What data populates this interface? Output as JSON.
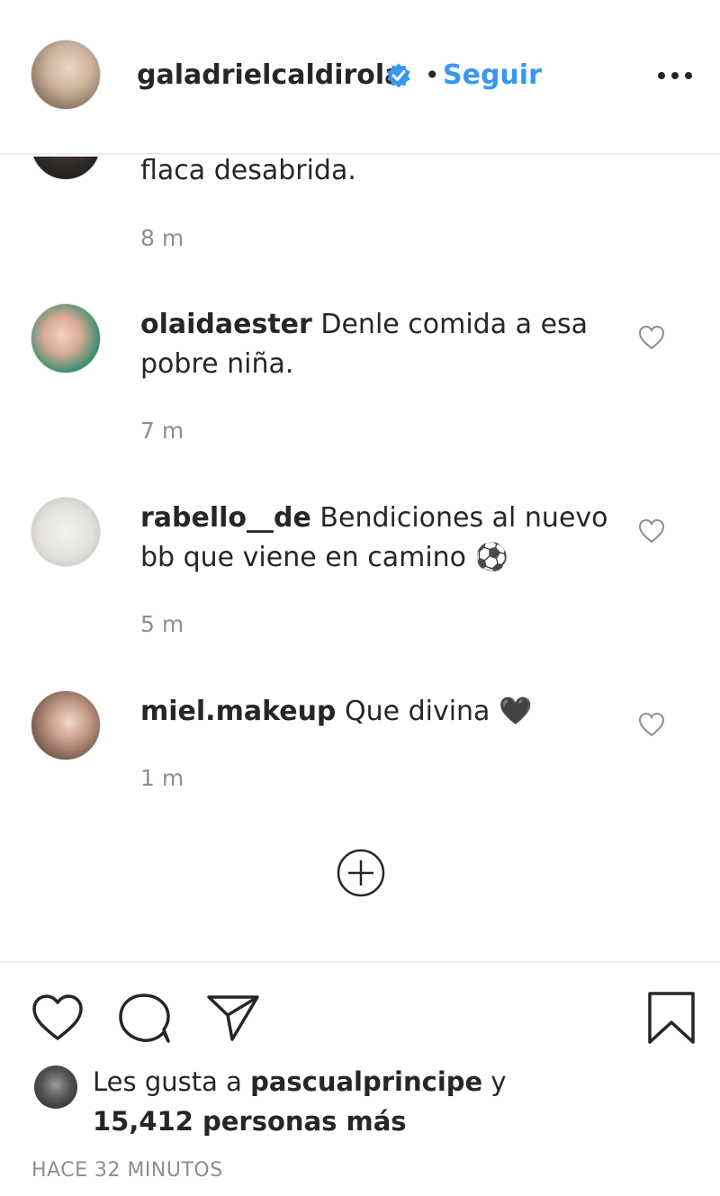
{
  "header": {
    "username": "galadrielcaldirola",
    "separator": "•",
    "follow_label": "Seguir"
  },
  "comments": [
    {
      "username": "",
      "text": "flaca desabrida.",
      "time": "8 m"
    },
    {
      "username": "olaidaester",
      "text": "Denle comida a esa pobre niña.",
      "time": "7 m"
    },
    {
      "username": "rabello__de",
      "text": "Bendiciones al nuevo bb que viene en camino ⚽",
      "time": "5 m"
    },
    {
      "username": "miel.makeup",
      "text": "Que divina 🖤",
      "time": "1 m"
    }
  ],
  "likes": {
    "prefix": "Les gusta a",
    "user": "pascualprincipe",
    "conjunction": "y",
    "others": "15,412 personas más"
  },
  "post_time": "HACE 32 MINUTOS",
  "colors": {
    "accent": "#3897f0",
    "text": "#262626",
    "muted": "#8e8e8e"
  }
}
